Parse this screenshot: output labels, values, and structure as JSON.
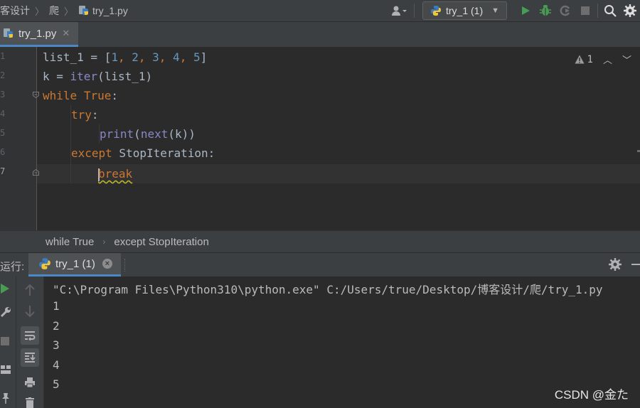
{
  "navbar": {
    "crumbs": [
      "客设计",
      "爬",
      "try_1.py"
    ],
    "run_config": "try_1 (1)"
  },
  "editor": {
    "tab_label": "try_1.py",
    "line_numbers": [
      "1",
      "2",
      "3",
      "4",
      "5",
      "6",
      "7"
    ],
    "inspection_count": "1",
    "lines": [
      [
        "list_1 = [",
        "1",
        ", ",
        "2",
        ", ",
        "3",
        ", ",
        "4",
        ", ",
        "5",
        "]"
      ],
      [
        "k = ",
        "iter",
        "(list_1)"
      ],
      [
        "while",
        " ",
        "True",
        ":"
      ],
      [
        "try",
        ":"
      ],
      [
        "print",
        "(",
        "next",
        "(k))"
      ],
      [
        "except",
        " StopIteration:"
      ],
      [
        "break"
      ]
    ]
  },
  "breadcrumbs": [
    "while True",
    "except StopIteration"
  ],
  "run": {
    "label": "运行:",
    "tab_label": "try_1 (1)",
    "output": [
      "\"C:\\Program Files\\Python310\\python.exe\" C:/Users/true/Desktop/博客设计/爬/try_1.py",
      "1",
      "2",
      "3",
      "4",
      "5"
    ]
  },
  "watermark": "CSDN @金た",
  "colors": {
    "accent": "#4a88c7",
    "keyword": "#cc7832",
    "number": "#6897bb",
    "builtin": "#8888c6",
    "run_green": "#499c54"
  }
}
